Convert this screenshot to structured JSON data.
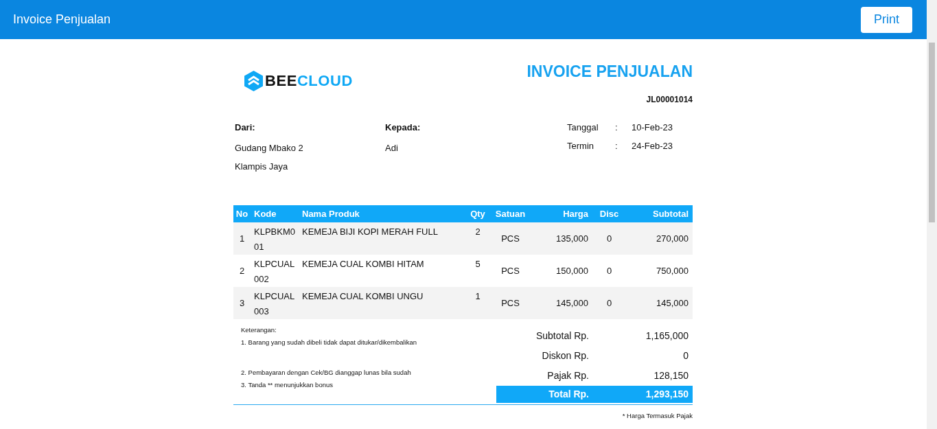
{
  "header": {
    "title": "Invoice Penjualan",
    "print_button": "Print"
  },
  "logo": {
    "dark_part": "BEE",
    "light_part": "CLOUD"
  },
  "invoice": {
    "title": "INVOICE PENJUALAN",
    "number": "JL00001014"
  },
  "from": {
    "label": "Dari:",
    "lines": [
      "Gudang Mbako 2",
      "Klampis Jaya"
    ]
  },
  "to": {
    "label": "Kepada:",
    "lines": [
      "Adi"
    ]
  },
  "dates": [
    {
      "label": "Tanggal",
      "separator": ":",
      "value": "10-Feb-23"
    },
    {
      "label": "Termin",
      "separator": ":",
      "value": "24-Feb-23"
    }
  ],
  "table": {
    "columns": [
      "No",
      "Kode",
      "Nama Produk",
      "Qty",
      "Satuan",
      "Harga",
      "Disc",
      "Subtotal"
    ],
    "rows": [
      [
        "1",
        "KLPBKM001",
        "KEMEJA BIJI KOPI MERAH FULL",
        "2",
        "PCS",
        "135,000",
        "0",
        "270,000"
      ],
      [
        "2",
        "KLPCUAL002",
        "KEMEJA CUAL KOMBI HITAM",
        "5",
        "PCS",
        "150,000",
        "0",
        "750,000"
      ],
      [
        "3",
        "KLPCUAL003",
        "KEMEJA CUAL KOMBI UNGU",
        "1",
        "PCS",
        "145,000",
        "0",
        "145,000"
      ]
    ]
  },
  "notes": {
    "title": "Keterangan:",
    "items": [
      "1. Barang yang sudah dibeli tidak dapat ditukar/dikembalikan",
      "2. Pembayaran dengan Cek/BG dianggap lunas bila sudah",
      "3. Tanda ** menunjukkan bonus"
    ]
  },
  "totals": [
    {
      "kind": "normal",
      "label": "Subtotal Rp.",
      "value": "1,165,000"
    },
    {
      "kind": "normal",
      "label": "Diskon Rp.",
      "value": "0"
    },
    {
      "kind": "normal",
      "label": "Pajak Rp.",
      "value": "128,150"
    },
    {
      "kind": "total",
      "label": "Total Rp.",
      "value": "1,293,150"
    }
  ],
  "footnote": "* Harga Termasuk Pajak"
}
